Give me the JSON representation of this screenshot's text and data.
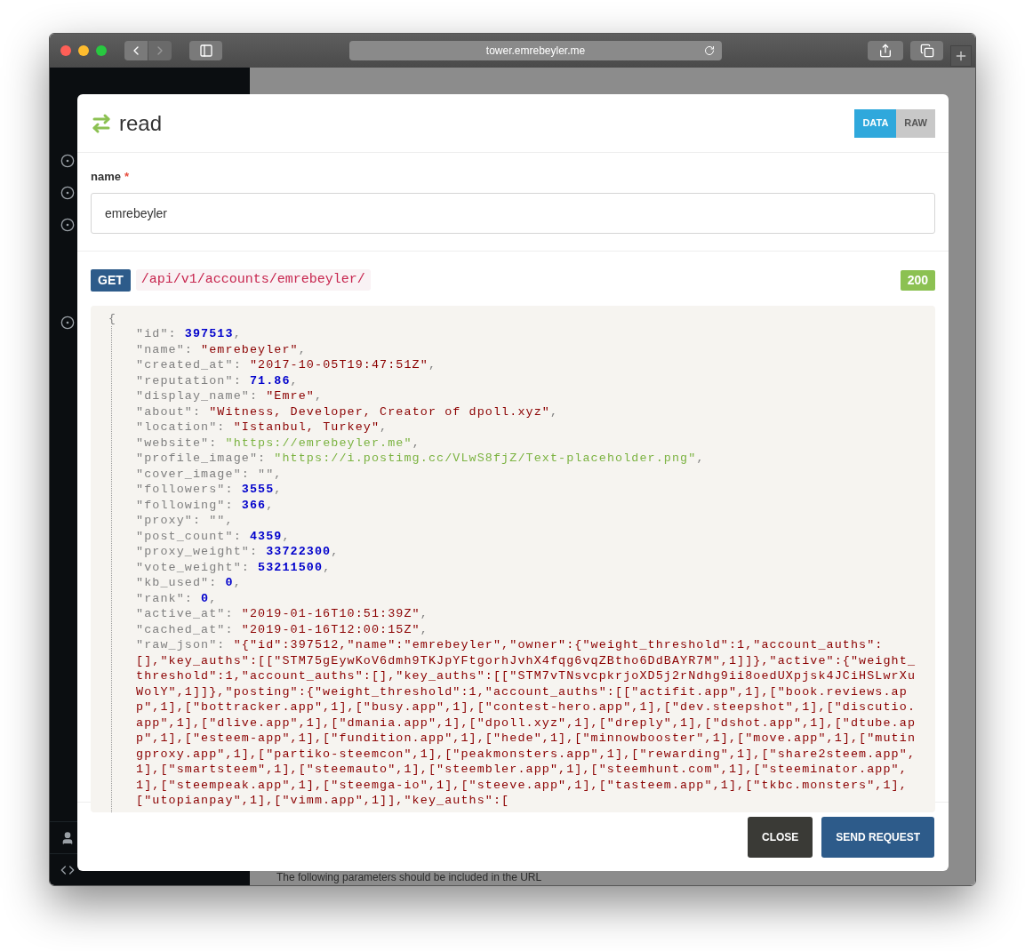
{
  "browser": {
    "url": "tower.emrebeyler.me"
  },
  "background": {
    "text": "The following parameters should be included in the URL"
  },
  "sidebar": {
    "items": [
      {
        "kind": "target"
      },
      {
        "kind": "target"
      },
      {
        "kind": "target"
      },
      {
        "kind": "target"
      }
    ],
    "bottom_items": [
      {
        "kind": "user"
      },
      {
        "kind": "code"
      }
    ]
  },
  "modal": {
    "title": "read",
    "view_tabs": [
      {
        "label": "DATA",
        "selected": true
      },
      {
        "label": "RAW",
        "selected": false
      }
    ],
    "field": {
      "label": "name",
      "required_mark": "*",
      "value": "emrebeyler"
    },
    "request": {
      "method": "GET",
      "path": "/api/v1/accounts/emrebeyler/",
      "status": "200"
    },
    "response": {
      "open": "{",
      "fields": [
        {
          "key": "\"id\": ",
          "value": "397513",
          "kind": "number",
          "punct": ","
        },
        {
          "key": "\"name\": ",
          "value": "\"emrebeyler\"",
          "kind": "string",
          "punct": ","
        },
        {
          "key": "\"created_at\": ",
          "value": "\"2017-10-05T19:47:51Z\"",
          "kind": "string",
          "punct": ","
        },
        {
          "key": "\"reputation\": ",
          "value": "71.86",
          "kind": "number",
          "punct": ","
        },
        {
          "key": "\"display_name\": ",
          "value": "\"Emre\"",
          "kind": "string",
          "punct": ","
        },
        {
          "key": "\"about\": ",
          "value": "\"Witness, Developer, Creator of dpoll.xyz\"",
          "kind": "string",
          "punct": ","
        },
        {
          "key": "\"location\": ",
          "value": "\"Istanbul, Turkey\"",
          "kind": "string",
          "punct": ","
        },
        {
          "key": "\"website\": ",
          "value": "\"https://emrebeyler.me\"",
          "kind": "link",
          "punct": ","
        },
        {
          "key": "\"profile_image\": ",
          "value": "\"https://i.postimg.cc/VLwS8fjZ/Text-placeholder.png\"",
          "kind": "link",
          "punct": ","
        },
        {
          "key": "\"cover_image\": ",
          "value": "\"\"",
          "kind": "plain",
          "punct": ","
        },
        {
          "key": "\"followers\": ",
          "value": "3555",
          "kind": "number",
          "punct": ","
        },
        {
          "key": "\"following\": ",
          "value": "366",
          "kind": "number",
          "punct": ","
        },
        {
          "key": "\"proxy\": ",
          "value": "\"\"",
          "kind": "plain",
          "punct": ","
        },
        {
          "key": "\"post_count\": ",
          "value": "4359",
          "kind": "number",
          "punct": ","
        },
        {
          "key": "\"proxy_weight\": ",
          "value": "33722300",
          "kind": "number",
          "punct": ","
        },
        {
          "key": "\"vote_weight\": ",
          "value": "53211500",
          "kind": "number",
          "punct": ","
        },
        {
          "key": "\"kb_used\": ",
          "value": "0",
          "kind": "number",
          "punct": ","
        },
        {
          "key": "\"rank\": ",
          "value": "0",
          "kind": "number",
          "punct": ","
        },
        {
          "key": "\"active_at\": ",
          "value": "\"2019-01-16T10:51:39Z\"",
          "kind": "string",
          "punct": ","
        },
        {
          "key": "\"cached_at\": ",
          "value": "\"2019-01-16T12:00:15Z\"",
          "kind": "string",
          "punct": ","
        },
        {
          "key": "\"raw_json\": ",
          "value": "\"{\"id\":397512,\"name\":\"emrebeyler\",\"owner\":{\"weight_threshold\":1,\"account_auths\":[],\"key_auths\":[[\"STM75gEywKoV6dmh9TKJpYFtgorhJvhX4fqg6vqZBtho6DdBAYR7M\",1]]},\"active\":{\"weight_threshold\":1,\"account_auths\":[],\"key_auths\":[[\"STM7vTNsvcpkrjoXD5j2rNdhg9ii8oedUXpjsk4JCiHSLwrXuWolY\",1]]},\"posting\":{\"weight_threshold\":1,\"account_auths\":[[\"actifit.app\",1],[\"book.reviews.app\",1],[\"bottracker.app\",1],[\"busy.app\",1],[\"contest-hero.app\",1],[\"dev.steepshot\",1],[\"discutio.app\",1],[\"dlive.app\",1],[\"dmania.app\",1],[\"dpoll.xyz\",1],[\"dreply\",1],[\"dshot.app\",1],[\"dtube.app\",1],[\"esteem-app\",1],[\"fundition.app\",1],[\"hede\",1],[\"minnowbooster\",1],[\"move.app\",1],[\"mutingproxy.app\",1],[\"partiko-steemcon\",1],[\"peakmonsters.app\",1],[\"rewarding\",1],[\"share2steem.app\",1],[\"smartsteem\",1],[\"steemauto\",1],[\"steembler.app\",1],[\"steemhunt.com\",1],[\"steeminator.app\",1],[\"steempeak.app\",1],[\"steemga-io\",1],[\"steeve.app\",1],[\"tasteem.app\",1],[\"tkbc.monsters\",1],[\"utopianpay\",1],[\"vimm.app\",1]],\"key_auths\":[",
          "kind": "string"
        }
      ]
    },
    "buttons": [
      {
        "label": "CLOSE",
        "kind": "secondary"
      },
      {
        "label": "SEND REQUEST",
        "kind": "primary"
      }
    ]
  }
}
